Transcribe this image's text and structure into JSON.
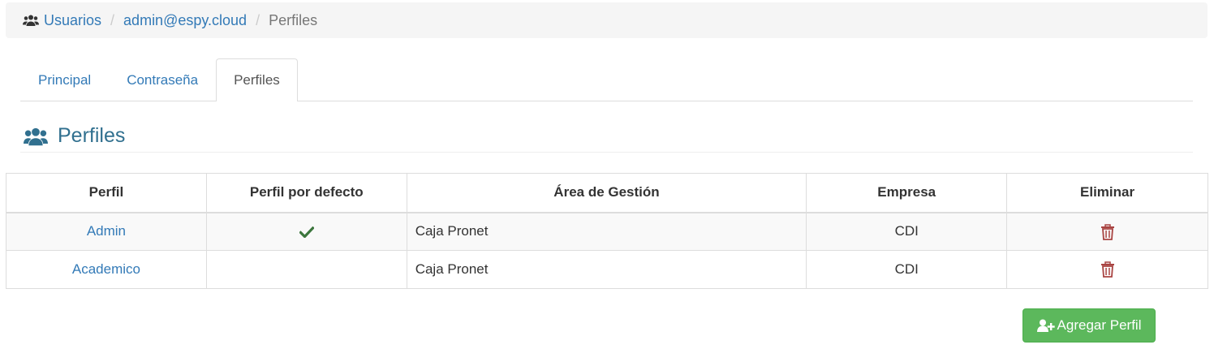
{
  "breadcrumb": {
    "icon": "users-icon",
    "items": [
      {
        "label": "Usuarios"
      },
      {
        "label": "admin@espy.cloud"
      },
      {
        "label": "Perfiles"
      }
    ],
    "separator": "/"
  },
  "tabs": [
    {
      "label": "Principal",
      "active": false
    },
    {
      "label": "Contraseña",
      "active": false
    },
    {
      "label": "Perfiles",
      "active": true
    }
  ],
  "section": {
    "icon": "users-icon",
    "title": "Perfiles"
  },
  "table": {
    "headers": [
      "Perfil",
      "Perfil por defecto",
      "Área de Gestión",
      "Empresa",
      "Eliminar"
    ],
    "rows": [
      {
        "perfil": "Admin",
        "default": true,
        "area": "Caja Pronet",
        "empresa": "CDI",
        "delete_icon": "trash-icon"
      },
      {
        "perfil": "Academico",
        "default": false,
        "area": "Caja Pronet",
        "empresa": "CDI",
        "delete_icon": "trash-icon"
      }
    ]
  },
  "actions": {
    "add_label": "Agregar Perfil",
    "add_icon": "user-plus-icon"
  },
  "colors": {
    "link": "#337ab7",
    "title": "#31708f",
    "success": "#5cb85c",
    "check": "#3c763d",
    "danger": "#a94442"
  }
}
